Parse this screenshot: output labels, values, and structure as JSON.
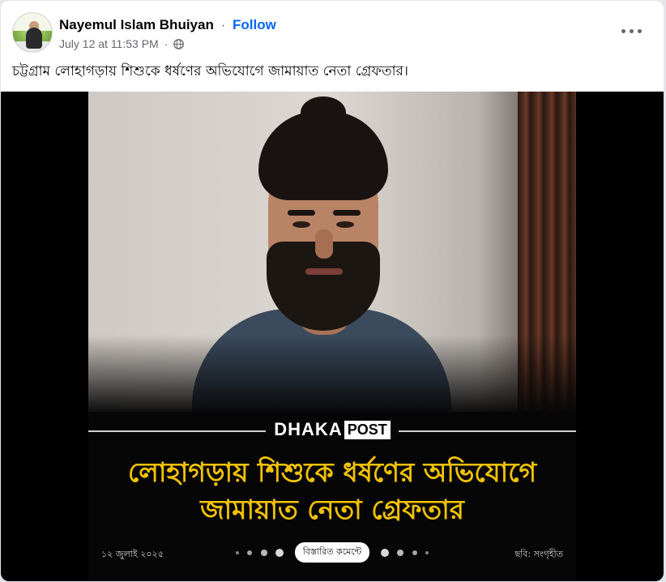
{
  "post": {
    "author": "Nayemul Islam Bhuiyan",
    "separator": "·",
    "follow_label": "Follow",
    "timestamp": "July 12 at 11:53 PM",
    "meta_separator": "·",
    "audience_icon": "globe-icon",
    "more_icon": "more-options-icon",
    "caption": "চট্টগ্রাম লোহাগড়ায় শিশুকে ধর্ষণের অভিযোগে জামায়াত নেতা গ্রেফতার।"
  },
  "image": {
    "brand_primary": "DHAKA",
    "brand_secondary": "POST",
    "headline_line1": "লোহাগড়ায় শিশুকে ধর্ষণের অভিযোগে",
    "headline_line2": "জামায়াত নেতা গ্রেফতার",
    "date": "১২ জুলাই ২০২৫",
    "details_label": "বিস্তারিত কমেন্টে",
    "credit": "ছবি: সংগৃহীত"
  },
  "colors": {
    "follow": "#0866ff",
    "headline": "#f2c200",
    "meta": "#65676b"
  }
}
